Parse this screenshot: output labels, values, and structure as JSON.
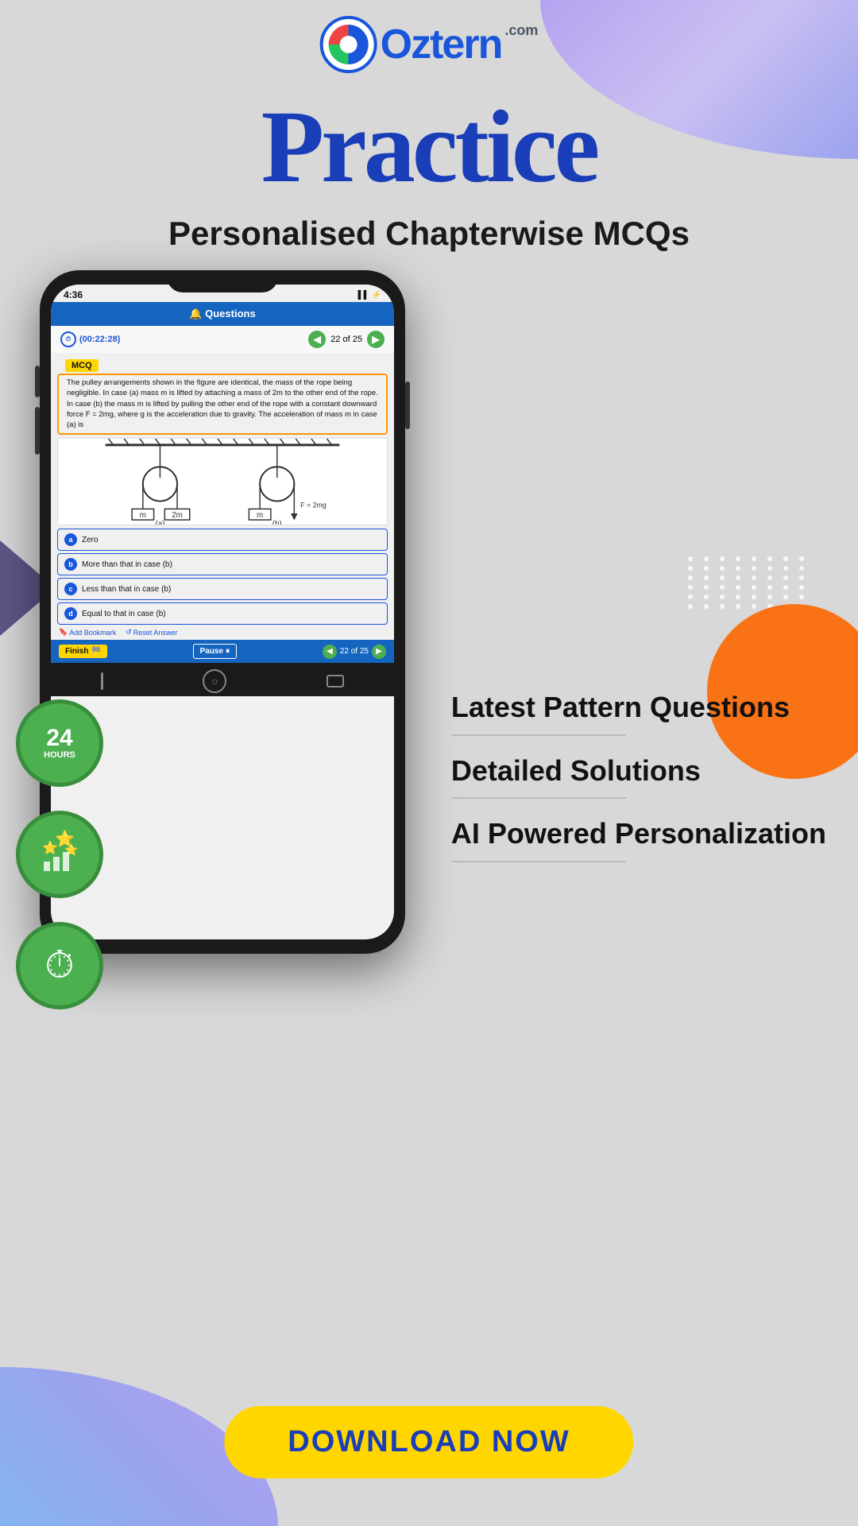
{
  "app": {
    "title": "Oztern",
    "tagline": ".com"
  },
  "header": {
    "practice_label": "Practice",
    "subtitle": "Personalised Chapterwise MCQs"
  },
  "phone": {
    "status_bar": {
      "time": "4:36",
      "icons": "▌▌▌ 🔋"
    },
    "app_header": "🔔 Questions",
    "timer": "(00:22:28)",
    "nav_label": "22 of 25",
    "mcq_badge": "MCQ",
    "question_text": "The pulley arrangements shown in the figure are identical, the mass of the rope being negligible. In case (a) mass m is lifted by attaching a mass of 2m to the other end of the rope. In case (b) the mass m is lifted by pulling the other end of the rope with a constant downward force F = 2mg, where g is the acceleration due to gravity. The acceleration of mass m in case (a) is",
    "options": [
      {
        "label": "a",
        "text": "Zero"
      },
      {
        "label": "b",
        "text": "More than that in case (b)"
      },
      {
        "label": "c",
        "text": "Less than that in case (b)"
      },
      {
        "label": "d",
        "text": "Equal to that in case (b)"
      }
    ],
    "add_bookmark": "Add Bookmark",
    "reset_answer": "Reset Answer",
    "finish_btn": "Finish",
    "pause_btn": "Pause",
    "bottom_nav": "22 of 25"
  },
  "features": [
    {
      "title": "Latest Pattern\nQuestions"
    },
    {
      "title": "Detailed\nSolutions"
    },
    {
      "title": "AI Powered\nPersonalization"
    }
  ],
  "green_icons": [
    {
      "line1": "24",
      "line2": "HOURS"
    },
    {
      "line1": "⭐",
      "line2": ""
    },
    {
      "line1": "⏱",
      "line2": ""
    }
  ],
  "download_btn": "DOWNLOAD NOW"
}
